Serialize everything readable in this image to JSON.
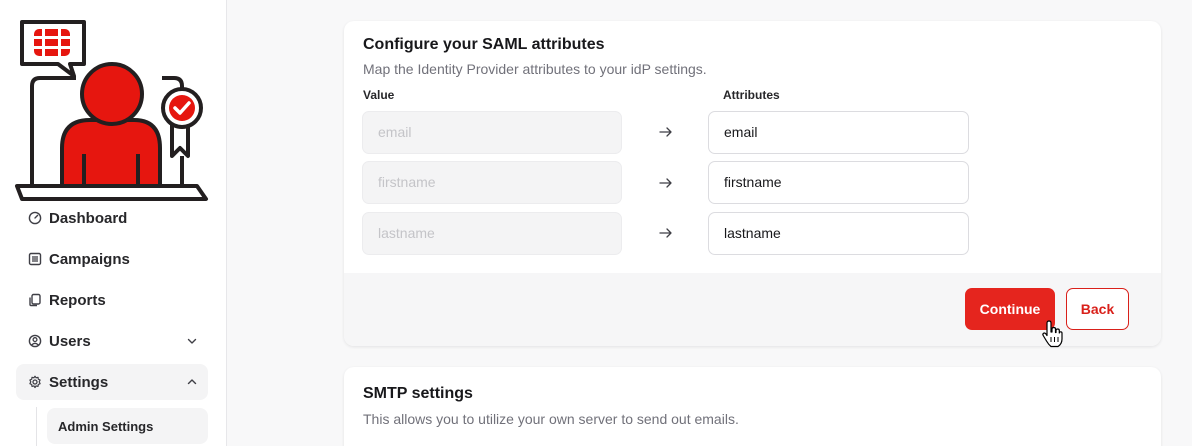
{
  "sidebar": {
    "items": [
      {
        "label": "Dashboard",
        "icon": "speedometer-icon"
      },
      {
        "label": "Campaigns",
        "icon": "columns-icon"
      },
      {
        "label": "Reports",
        "icon": "copy-icon"
      },
      {
        "label": "Users",
        "icon": "user-circle-icon"
      },
      {
        "label": "Settings",
        "icon": "gear-icon"
      }
    ],
    "sub_items": [
      {
        "label": "Admin Settings"
      }
    ]
  },
  "saml": {
    "title": "Configure your SAML attributes",
    "subtitle": "Map the Identity Provider attributes to your idP settings.",
    "value_header": "Value",
    "attributes_header": "Attributes",
    "rows": [
      {
        "placeholder": "email",
        "attribute": "email"
      },
      {
        "placeholder": "firstname",
        "attribute": "firstname"
      },
      {
        "placeholder": "lastname",
        "attribute": "lastname"
      }
    ],
    "continue_label": "Continue",
    "back_label": "Back"
  },
  "smtp": {
    "title": "SMTP settings",
    "subtitle": "This allows you to utilize your own server to send out emails."
  },
  "colors": {
    "accent": "#e5251e",
    "logo_red": "#e6160f",
    "outline": "#231f20"
  }
}
